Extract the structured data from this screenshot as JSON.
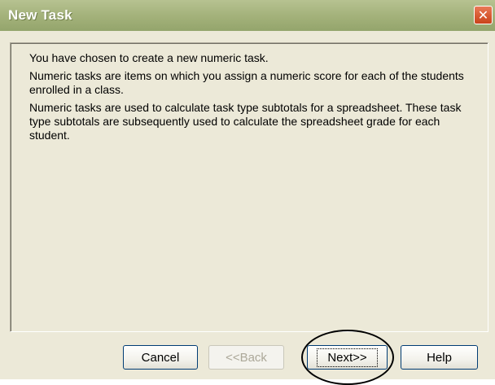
{
  "window": {
    "title": "New Task",
    "close_glyph": "✕",
    "close_icon": "close-icon"
  },
  "content": {
    "paragraphs": [
      "You have chosen to create a new numeric task.",
      "Numeric tasks are items on which you assign a numeric score for each of the students enrolled in a class.",
      "Numeric tasks are used to calculate task type subtotals for a spreadsheet. These task type subtotals are subsequently used to calculate the spreadsheet grade for each student."
    ]
  },
  "buttons": {
    "cancel": "Cancel",
    "back": "<<Back",
    "next": "Next>>",
    "help": "Help"
  },
  "colors": {
    "titlebar": "#a4b27b",
    "close_button": "#d85a32",
    "dialog_background": "#ece9d8"
  }
}
